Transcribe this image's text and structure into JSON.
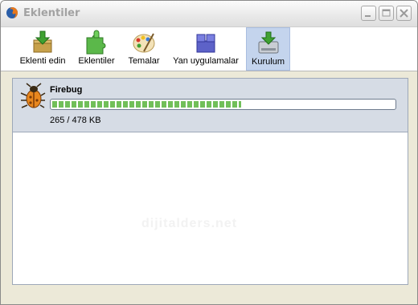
{
  "window": {
    "title": "Eklentiler",
    "app_icon": "firefox-icon"
  },
  "window_controls": {
    "minimize_icon": "minimize-icon",
    "maximize_icon": "maximize-icon",
    "close_icon": "close-icon"
  },
  "toolbar": {
    "items": [
      {
        "label": "Eklenti edin",
        "icon": "get-addons-icon",
        "selected": false
      },
      {
        "label": "Eklentiler",
        "icon": "extensions-puzzle-icon",
        "selected": false
      },
      {
        "label": "Temalar",
        "icon": "themes-palette-icon",
        "selected": false
      },
      {
        "label": "Yan uygulamalar",
        "icon": "plugins-blocks-icon",
        "selected": false
      },
      {
        "label": "Kurulum",
        "icon": "install-drive-icon",
        "selected": true
      }
    ]
  },
  "downloads": [
    {
      "name": "Firebug",
      "icon": "firebug-icon",
      "size_text": "265 / 478 KB",
      "progress": 0.554
    }
  ],
  "watermark": "dijitalders.net",
  "colors": {
    "selected_tab": "#c4d4ed",
    "progress_green": "#71bf59",
    "item_bg": "#d6dce5",
    "window_bg": "#ece9d8"
  }
}
